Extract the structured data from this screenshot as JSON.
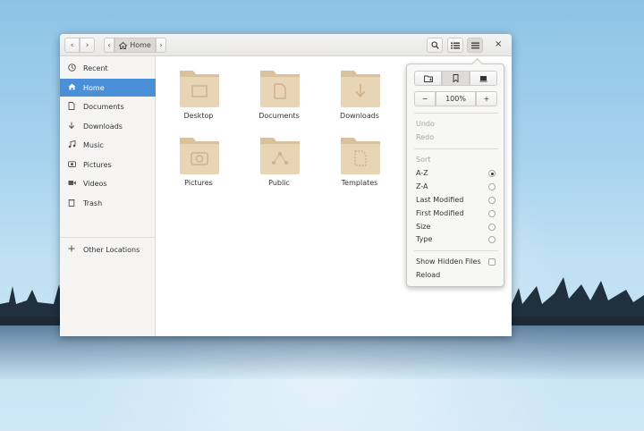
{
  "headerbar": {
    "back_icon": "‹",
    "forward_icon": "›",
    "path_left_arrow": "‹",
    "path_home_label": "Home",
    "path_right_arrow": "›",
    "search_icon": "search-icon",
    "view_icon": "list-view-icon",
    "menu_icon": "hamburger-menu-icon",
    "close_label": "×"
  },
  "sidebar": {
    "items": [
      {
        "label": "Recent",
        "icon": "clock-icon"
      },
      {
        "label": "Home",
        "icon": "home-icon"
      },
      {
        "label": "Documents",
        "icon": "document-icon"
      },
      {
        "label": "Downloads",
        "icon": "download-icon"
      },
      {
        "label": "Music",
        "icon": "music-icon"
      },
      {
        "label": "Pictures",
        "icon": "camera-icon"
      },
      {
        "label": "Videos",
        "icon": "video-icon"
      },
      {
        "label": "Trash",
        "icon": "trash-icon"
      }
    ],
    "other_locations": {
      "label": "Other Locations",
      "icon": "plus-icon"
    }
  },
  "folders": [
    {
      "label": "Desktop",
      "emblem": "desktop-emblem-icon"
    },
    {
      "label": "Documents",
      "emblem": "document-emblem-icon"
    },
    {
      "label": "Downloads",
      "emblem": "download-emblem-icon"
    },
    {
      "label": "Pictures",
      "emblem": "camera-emblem-icon"
    },
    {
      "label": "Public",
      "emblem": "share-emblem-icon"
    },
    {
      "label": "Templates",
      "emblem": "template-emblem-icon"
    }
  ],
  "menu": {
    "zoom_out": "−",
    "zoom_level": "100%",
    "zoom_in": "+",
    "undo": "Undo",
    "redo": "Redo",
    "sort_heading": "Sort",
    "sort_options": [
      {
        "label": "A-Z",
        "selected": true
      },
      {
        "label": "Z-A",
        "selected": false
      },
      {
        "label": "Last Modified",
        "selected": false
      },
      {
        "label": "First Modified",
        "selected": false
      },
      {
        "label": "Size",
        "selected": false
      },
      {
        "label": "Type",
        "selected": false
      }
    ],
    "show_hidden": "Show Hidden Files",
    "reload": "Reload"
  },
  "colors": {
    "accent": "#4a90d9",
    "folder": "#e8d5b5",
    "folder_tab": "#d9c19b"
  }
}
